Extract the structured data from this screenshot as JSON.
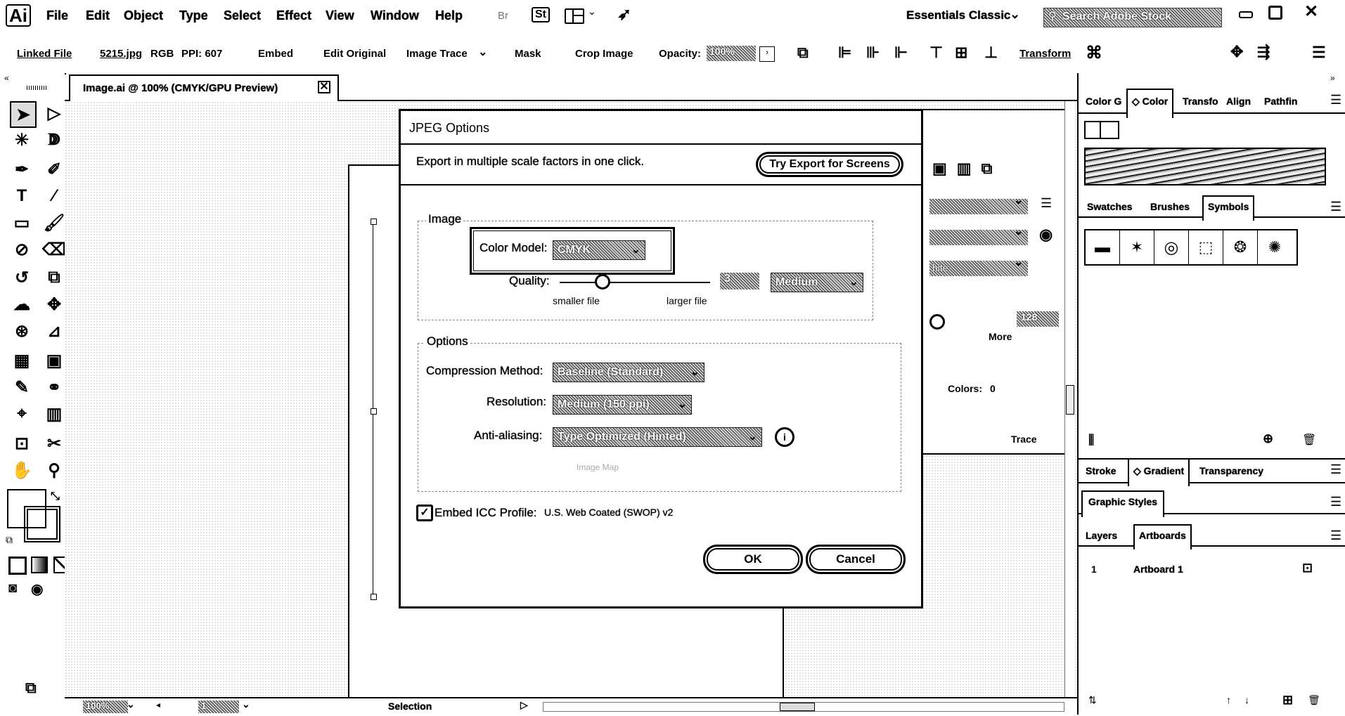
{
  "app": {
    "logo": "Ai"
  },
  "menu": [
    "File",
    "Edit",
    "Object",
    "Type",
    "Select",
    "Effect",
    "View",
    "Window",
    "Help"
  ],
  "menu_extra": {
    "bridge": "Br",
    "stock": "St"
  },
  "workspace": "Essentials Classic",
  "search_placeholder": "Search Adobe Stock",
  "control_bar": {
    "linked_file": "Linked File",
    "file_name": "5215.jpg",
    "color_mode": "RGB",
    "ppi": "PPI: 607",
    "embed": "Embed",
    "edit_original": "Edit Original",
    "image_trace": "Image Trace",
    "mask": "Mask",
    "crop_image": "Crop Image",
    "opacity_label": "Opacity:",
    "opacity_value": "100%",
    "transform": "Transform"
  },
  "doc_tab": "Image.ai @ 100% (CMYK/GPU Preview)",
  "right_panels": {
    "top_tabs": [
      "Color G",
      "Color",
      "Transfo",
      "Align",
      "Pathfin"
    ],
    "mid_tabs": [
      "Swatches",
      "Brushes",
      "Symbols"
    ],
    "grad_tabs": [
      "Stroke",
      "Gradient",
      "Transparency"
    ],
    "styles_tab": "Graphic Styles",
    "layers_tabs": [
      "Layers",
      "Artboards"
    ],
    "artboard_row": {
      "index": "1",
      "name": "Artboard 1"
    }
  },
  "trace_panel": {
    "hite": "hite",
    "value": "128",
    "more": "More",
    "colors_label": "Colors:",
    "colors_value": "0",
    "trace": "Trace"
  },
  "status_bar": {
    "zoom": "100%",
    "artboard": "1",
    "tool": "Selection"
  },
  "dialog": {
    "title": "JPEG Options",
    "banner_text": "Export in multiple scale factors in one click.",
    "banner_button": "Try Export for Screens",
    "image_group": "Image",
    "color_model_label": "Color Model:",
    "color_model_value": "CMYK",
    "quality_label": "Quality:",
    "quality_value": "3",
    "quality_preset": "Medium",
    "smaller_file": "smaller file",
    "larger_file": "larger file",
    "options_group": "Options",
    "compression_label": "Compression Method:",
    "compression_value": "Baseline (Standard)",
    "resolution_label": "Resolution:",
    "resolution_value": "Medium (150 ppi)",
    "antialias_label": "Anti-aliasing:",
    "antialias_value": "Type Optimized (Hinted)",
    "imagemap_label": "Image Map",
    "icc_label": "Embed ICC Profile:",
    "icc_value": "U.S. Web Coated (SWOP) v2",
    "icc_checked": true,
    "ok": "OK",
    "cancel": "Cancel"
  }
}
